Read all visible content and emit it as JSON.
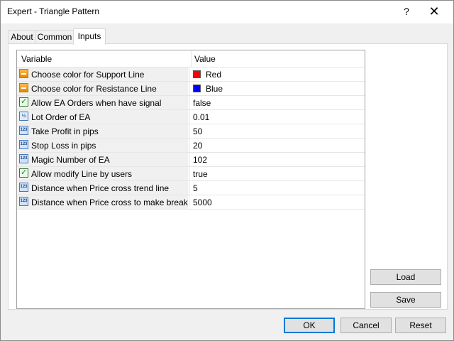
{
  "window": {
    "title": "Expert - Triangle Pattern",
    "help_glyph": "?",
    "close_glyph": "✕"
  },
  "tabs": [
    {
      "label": "About",
      "active": false
    },
    {
      "label": "Common",
      "active": false
    },
    {
      "label": "Inputs",
      "active": true
    }
  ],
  "grid": {
    "headers": {
      "variable": "Variable",
      "value": "Value"
    },
    "rows": [
      {
        "label": "Choose color for Support Line",
        "value": "Red",
        "icon": "color-icon",
        "swatch": "#ff0000"
      },
      {
        "label": "Choose color for Resistance Line",
        "value": "Blue",
        "icon": "color-icon",
        "swatch": "#0000ff"
      },
      {
        "label": "Allow EA Orders when have signal",
        "value": "false",
        "icon": "bool-icon"
      },
      {
        "label": "Lot Order of EA",
        "value": "0.01",
        "icon": "fraction-icon"
      },
      {
        "label": "Take Profit in pips",
        "value": "50",
        "icon": "number-icon"
      },
      {
        "label": "Stop Loss in pips",
        "value": "20",
        "icon": "number-icon"
      },
      {
        "label": "Magic Number of EA",
        "value": "102",
        "icon": "number-icon"
      },
      {
        "label": "Allow modify Line by users",
        "value": "true",
        "icon": "bool-icon"
      },
      {
        "label": "Distance when Price cross trend line",
        "value": "5",
        "icon": "number-icon"
      },
      {
        "label": "Distance when Price cross to make break trend",
        "value": "5000",
        "icon": "number-icon"
      }
    ]
  },
  "side_buttons": {
    "load": "Load",
    "save": "Save"
  },
  "footer_buttons": {
    "ok": "OK",
    "cancel": "Cancel",
    "reset": "Reset"
  },
  "colors": {
    "accent": "#0078d7"
  }
}
